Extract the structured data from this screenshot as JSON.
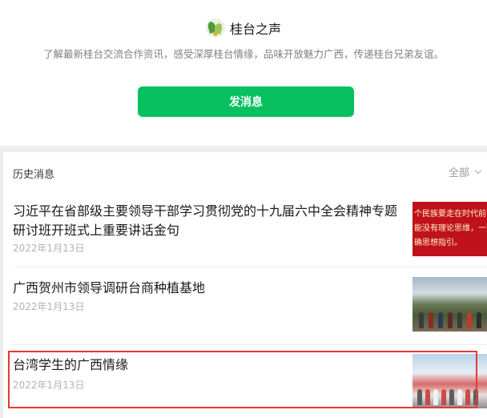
{
  "account": {
    "name": "桂台之声",
    "intro": "了解最新桂台交流合作资讯，感受深厚桂台情缘，品味开放魅力广西，传递桂台兄弟友谊。"
  },
  "actions": {
    "send_label": "发消息"
  },
  "history": {
    "title": "历史消息",
    "filter_label": "全部",
    "articles": [
      {
        "title": "习近平在省部级主要领导干部学习贯彻党的十九届六中全会精神专题研讨班开班式上重要讲话金句",
        "date": "2022年1月13日",
        "thumb_lines": [
          "个民族要走在时代前列",
          "能没有理论思维，一刻",
          "确思想指引。"
        ]
      },
      {
        "title": "广西贺州市领导调研台商种植基地",
        "date": "2022年1月13日"
      },
      {
        "title": "台湾学生的广西情缘",
        "date": "2022年1月13日"
      }
    ]
  },
  "colors": {
    "accent_green": "#07c160",
    "highlight_red": "#e53935"
  },
  "icons": {
    "avatar": "account-logo-icon",
    "filter": "chevron-down-icon"
  }
}
